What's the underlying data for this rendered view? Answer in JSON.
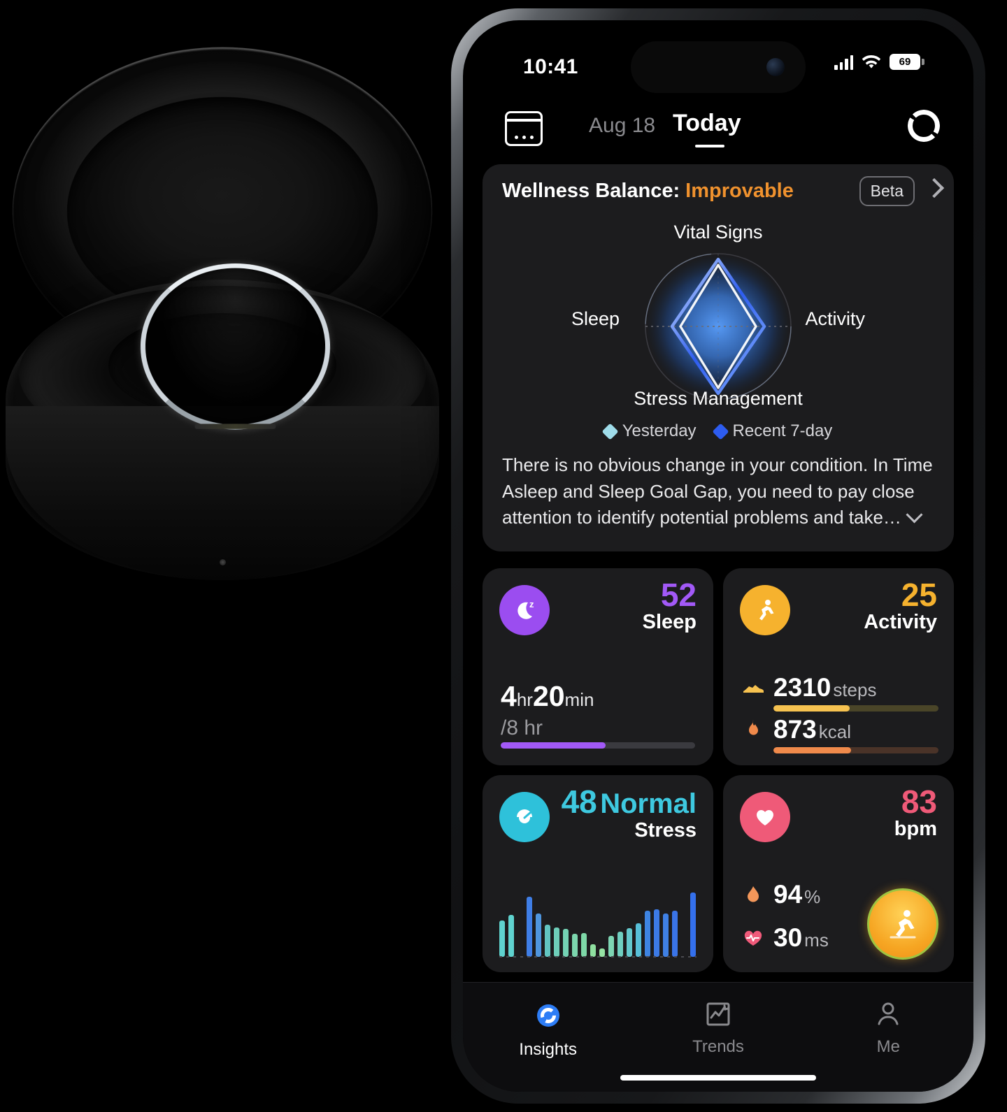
{
  "status_bar": {
    "time": "10:41",
    "battery": "69",
    "signal_icon": "cellular-signal-icon",
    "wifi_icon": "wifi-icon"
  },
  "nav": {
    "calendar_icon": "calendar-icon",
    "date": "Aug 18",
    "today": "Today",
    "sync_icon": "sync-ring-icon"
  },
  "wellness": {
    "title": "Wellness Balance:",
    "status": "Improvable",
    "status_color": "#f0922e",
    "beta_label": "Beta",
    "chevron_icon": "chevron-right-icon",
    "chart_title": "Vital Signs",
    "axis_left": "Sleep",
    "axis_right": "Activity",
    "axis_bottom": "Stress Management",
    "legend": [
      {
        "label": "Yesterday",
        "color": "#9fdcea"
      },
      {
        "label": "Recent 7-day",
        "color": "#2d5cf0"
      }
    ],
    "description": "There is no obvious change in your condition. In Time Asleep and Sleep Goal Gap, you need to pay close attention to identify potential problems and take…",
    "expand_icon": "chevron-down-icon"
  },
  "cards": {
    "sleep": {
      "icon": "sleep-moon-icon",
      "icon_bg": "#9b4df0",
      "score": "52",
      "score_color": "#a259f7",
      "label": "Sleep",
      "hours": "4",
      "hours_unit": "hr",
      "minutes": "20",
      "minutes_unit": "min",
      "goal": "/8 hr",
      "progress_pct": 54,
      "progress_color": "#a259f7"
    },
    "activity": {
      "icon": "running-icon",
      "icon_bg": "#f6b22e",
      "score": "25",
      "score_color": "#f6b22e",
      "label": "Activity",
      "rows": [
        {
          "icon": "shoe-icon",
          "value": "2310",
          "unit": "steps",
          "progress_pct": 46,
          "color": "#f6c250"
        },
        {
          "icon": "flame-icon",
          "value": "873",
          "unit": "kcal",
          "progress_pct": 47,
          "color": "#f08a4b"
        }
      ]
    },
    "stress": {
      "icon": "stress-gauge-icon",
      "icon_bg": "#2ec1da",
      "score": "48",
      "score_color": "#3ec9e0",
      "status": "Normal",
      "label": "Stress"
    },
    "heart": {
      "icon": "heart-icon",
      "icon_bg": "#ef5a78",
      "score": "83",
      "score_color": "#ef5a78",
      "label": "bpm",
      "rows": [
        {
          "icon": "blood-drop-icon",
          "value": "94",
          "unit": "%"
        },
        {
          "icon": "heart-pulse-icon",
          "value": "30",
          "unit": "ms"
        }
      ],
      "fab_icon": "running-workout-icon"
    }
  },
  "tabbar": {
    "items": [
      {
        "label": "Insights",
        "icon": "insights-ring-icon",
        "active": true
      },
      {
        "label": "Trends",
        "icon": "trends-chart-icon",
        "active": false
      },
      {
        "label": "Me",
        "icon": "person-icon",
        "active": false
      }
    ],
    "active_color": "#2d7df6",
    "inactive_color": "#8a8a8e"
  },
  "product": {
    "name": "smart-ring-charging-case"
  },
  "chart_data": [
    {
      "type": "line",
      "name": "vital-signs-radar",
      "title": "Vital Signs",
      "axes": [
        "Activity",
        "Stress Management",
        "Sleep"
      ],
      "legend_position": "bottom",
      "series": [
        {
          "name": "Yesterday",
          "color": "#9fdcea",
          "values": [
            0.52,
            0.95,
            0.52
          ]
        },
        {
          "name": "Recent 7-day",
          "color": "#2d5cf0",
          "values": [
            0.62,
            1.0,
            0.62
          ]
        }
      ],
      "grid": true
    },
    {
      "type": "bar",
      "name": "stress-trend",
      "title": "Stress",
      "ylabel": "",
      "xlabel": "",
      "ylim": [
        0,
        100
      ],
      "values": [
        52,
        60,
        0,
        86,
        62,
        46,
        42,
        40,
        33,
        34,
        18,
        12,
        30,
        36,
        41,
        48,
        66,
        68,
        62,
        66,
        0,
        92
      ],
      "colors": [
        "#5fd3cf",
        "#5fd3cf",
        "#000000",
        "#3f7ee6",
        "#4f95dd",
        "#62c5c2",
        "#6ecfba",
        "#74d2b4",
        "#7cd6ae",
        "#7ed8a8",
        "#8fe0a0",
        "#96e3a4",
        "#7ed6b4",
        "#6fcfc0",
        "#63c8cd",
        "#57bfd8",
        "#3e84e2",
        "#3c7ae6",
        "#3f80e4",
        "#3a74e8",
        "#000000",
        "#3470ec"
      ]
    }
  ]
}
